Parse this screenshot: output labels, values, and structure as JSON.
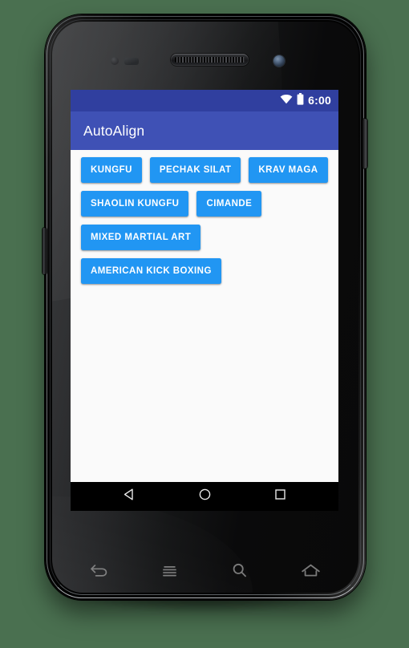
{
  "device": {
    "name": "android-phone",
    "background_color": "#4a7050",
    "hardware": {
      "earpiece": "earpiece-speaker",
      "proximity_sensor": "proximity-sensor",
      "light_sensor": "light-sensor",
      "front_camera": "front-camera",
      "power_button": "power-button",
      "volume_button": "volume-button"
    },
    "capacitive_keys": [
      {
        "name": "back-key",
        "icon": "back-arrow-icon"
      },
      {
        "name": "menu-key",
        "icon": "menu-hamburger-icon"
      },
      {
        "name": "search-key",
        "icon": "search-magnifier-icon"
      },
      {
        "name": "home-key",
        "icon": "home-icon"
      }
    ]
  },
  "status_bar": {
    "background_color": "#303f9f",
    "time": "6:00",
    "icons": [
      {
        "name": "wifi-icon",
        "label": "wifi"
      },
      {
        "name": "battery-icon",
        "label": "battery"
      }
    ]
  },
  "app_bar": {
    "background_color": "#3f51b5",
    "title": "AutoAlign"
  },
  "content": {
    "background_color": "#fafafa",
    "button_color": "#2196f3",
    "button_text_color": "#ffffff",
    "buttons": [
      {
        "label": "KUNGFU"
      },
      {
        "label": "PECHAK SILAT"
      },
      {
        "label": "KRAV MAGA"
      },
      {
        "label": "SHAOLIN KUNGFU"
      },
      {
        "label": "CIMANDE"
      },
      {
        "label": "MIXED MARTIAL ART"
      },
      {
        "label": "AMERICAN KICK BOXING"
      }
    ]
  },
  "nav_bar": {
    "background_color": "#000000",
    "buttons": [
      {
        "name": "nav-back-button",
        "icon": "back-triangle-icon"
      },
      {
        "name": "nav-home-button",
        "icon": "home-circle-icon"
      },
      {
        "name": "nav-recents-button",
        "icon": "recents-square-icon"
      }
    ]
  }
}
